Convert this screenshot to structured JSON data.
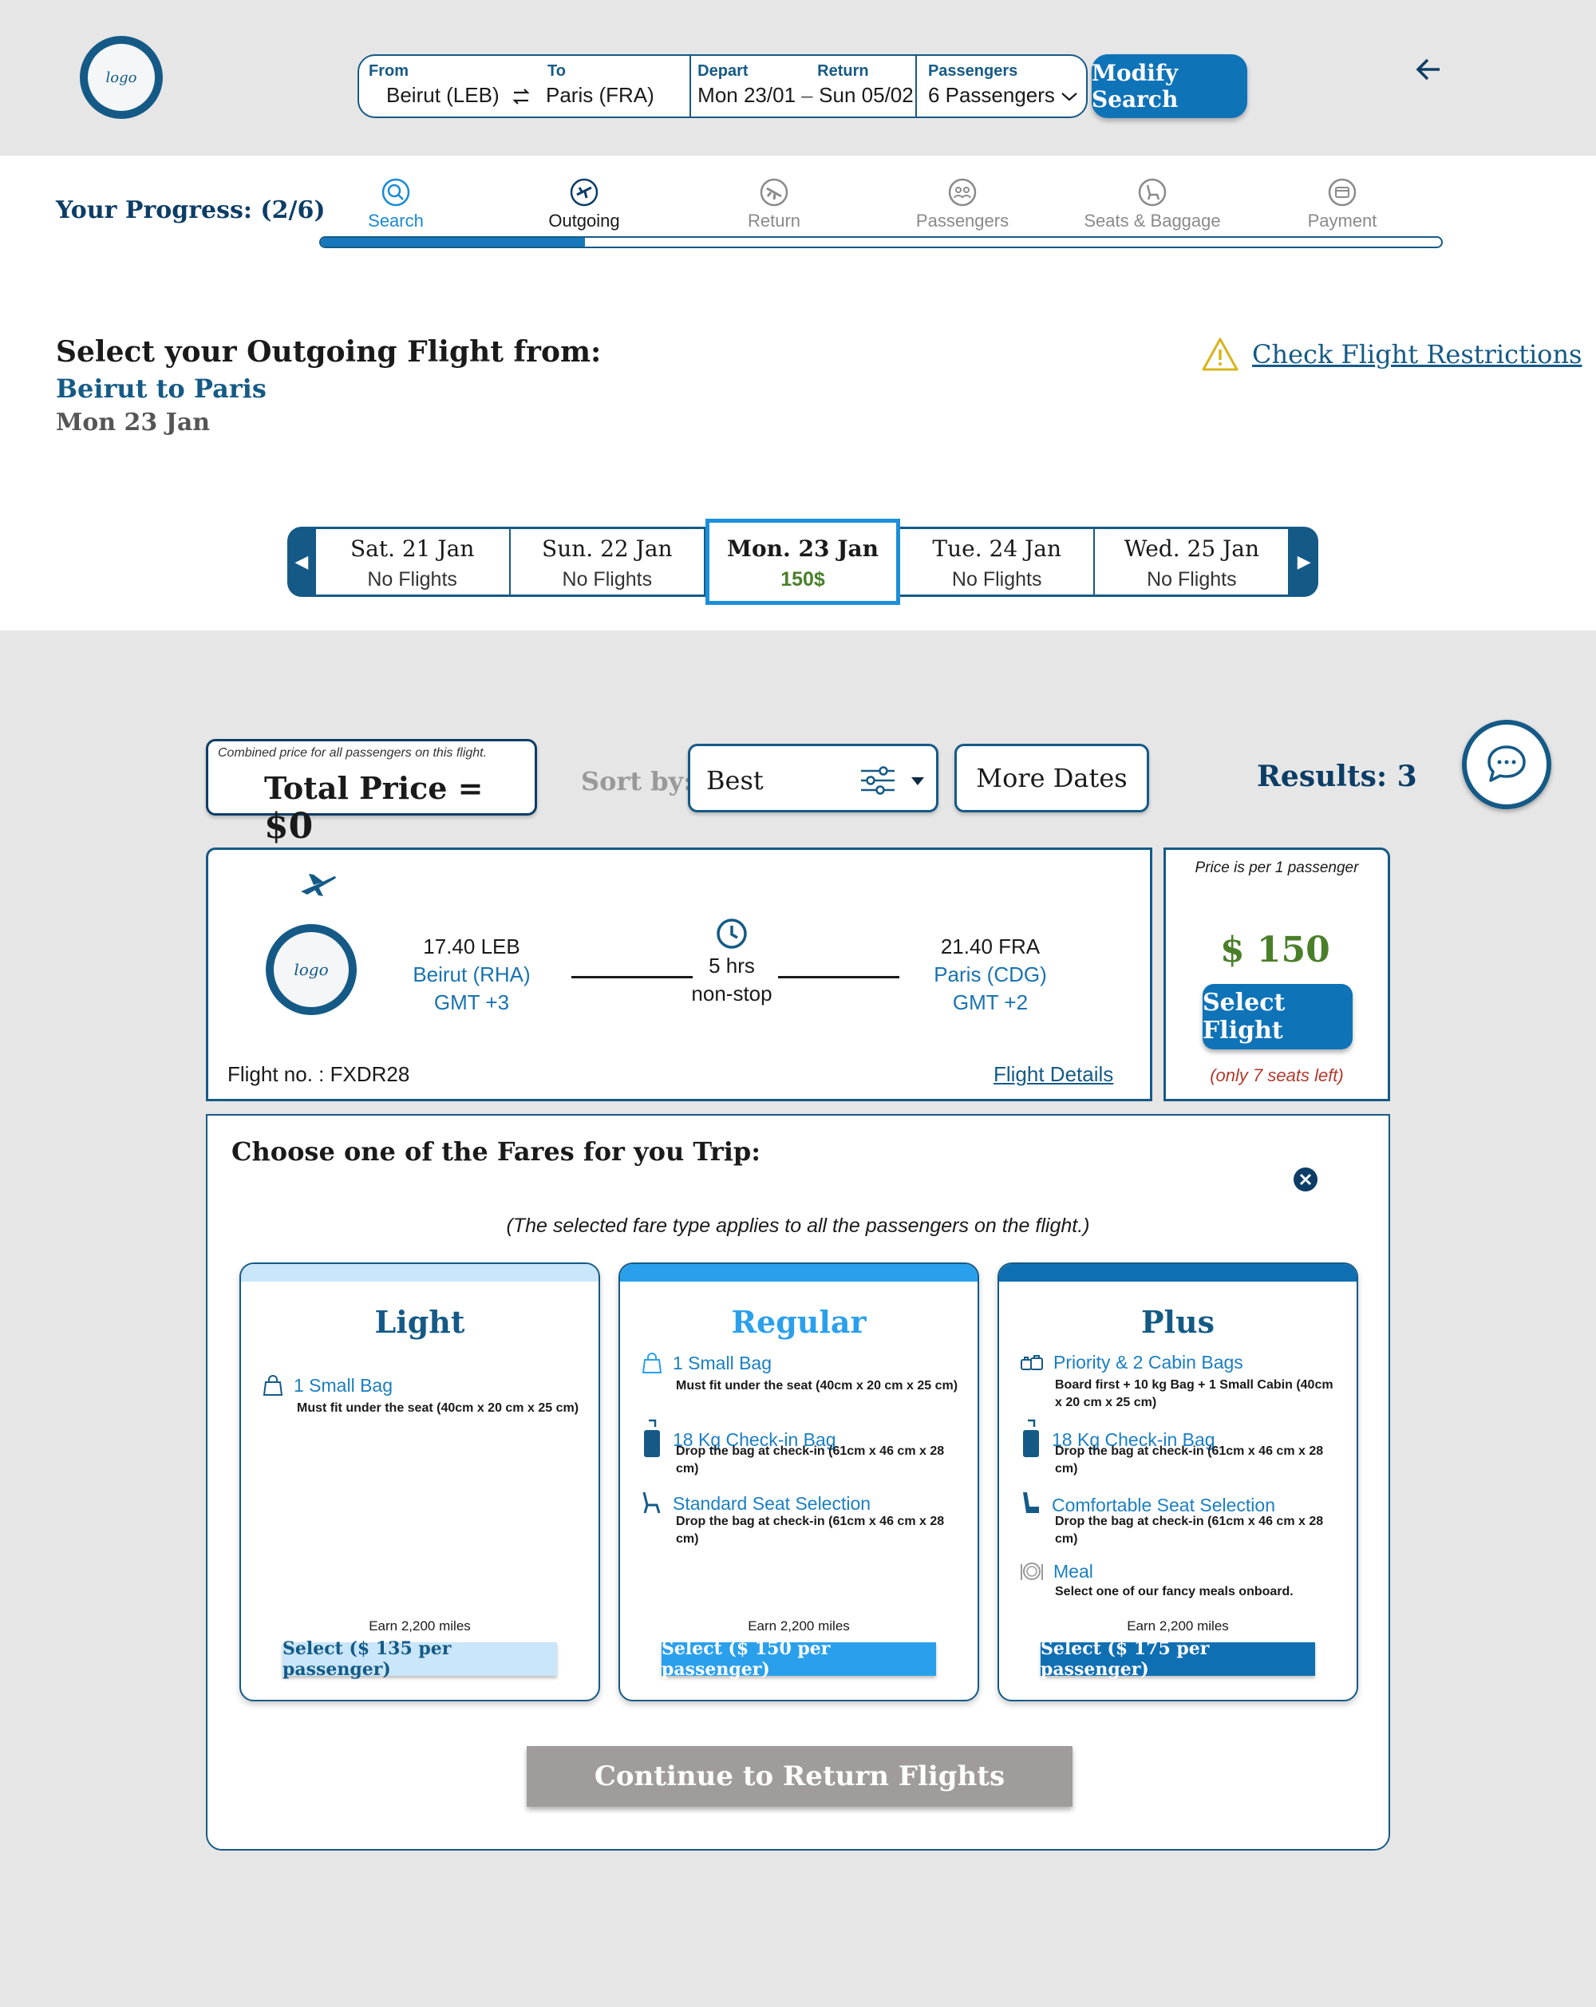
{
  "header": {
    "logo_text": "logo",
    "search": {
      "from_label": "From",
      "from_value": "Beirut (LEB)",
      "to_label": "To",
      "to_value": "Paris (FRA)",
      "depart_label": "Depart",
      "depart_value": "Mon 23/01",
      "date_sep": "–",
      "return_label": "Return",
      "return_value": "Sun 05/02",
      "passengers_label": "Passengers",
      "passengers_value": "6 Passengers"
    },
    "modify_label": "Modify Search"
  },
  "progress": {
    "label": "Your Progress: (2/6)",
    "fraction": 0.236,
    "steps": [
      {
        "label": "Search",
        "icon": "search-icon",
        "state": "done"
      },
      {
        "label": "Outgoing",
        "icon": "plane-icon",
        "state": "current"
      },
      {
        "label": "Return",
        "icon": "plane-landing-icon",
        "state": "todo"
      },
      {
        "label": "Passengers",
        "icon": "passengers-icon",
        "state": "todo"
      },
      {
        "label": "Seats & Baggage",
        "icon": "seat-icon",
        "state": "todo"
      },
      {
        "label": "Payment",
        "icon": "card-icon",
        "state": "todo"
      }
    ]
  },
  "selection": {
    "title": "Select your Outgoing Flight from:",
    "route": "Beirut to Paris",
    "date": "Mon 23 Jan",
    "restrictions_link": "Check Flight Restrictions"
  },
  "dates": [
    {
      "day": "Sat. 21 Jan",
      "price": "No Flights"
    },
    {
      "day": "Sun. 22 Jan",
      "price": "No Flights"
    },
    {
      "day": "Mon. 23 Jan",
      "price": "150$",
      "selected": true
    },
    {
      "day": "Tue. 24 Jan",
      "price": "No Flights"
    },
    {
      "day": "Wed. 25 Jan",
      "price": "No Flights"
    }
  ],
  "controls": {
    "total_note": "Combined price for all passengers on this flight.",
    "total_label": "Total Price =",
    "total_value": "$0",
    "sort_label": "Sort by:",
    "sort_value": "Best",
    "more_dates": "More Dates",
    "results": "Results: 3"
  },
  "flight": {
    "logo_text": "logo",
    "dep_time": "17.40 LEB",
    "dep_airport": "Beirut (RHA)",
    "dep_tz": "GMT +3",
    "duration": "5 hrs",
    "stops": "non-stop",
    "arr_time": "21.40 FRA",
    "arr_airport": "Paris (CDG)",
    "arr_tz": "GMT +2",
    "flight_no": "Flight no. : FXDR28",
    "details_link": "Flight Details",
    "price_note": "Price is per 1 passenger",
    "price": "$ 150",
    "select_label": "Select Flight",
    "seats_left": "(only 7 seats left)"
  },
  "fares": {
    "title": "Choose one of the Fares for you Trip:",
    "note": "(The selected fare type applies to all the passengers on the flight.)",
    "cards": [
      {
        "name": "Light",
        "top_color": "#c9e6fa",
        "name_color": "#155a86",
        "features": [
          {
            "icon": "bag-icon",
            "title": "1 Small Bag",
            "desc": "Must fit under the seat (40cm x 20 cm x 25 cm)"
          }
        ],
        "miles": "Earn 2,200 miles",
        "button": "Select  ($ 135 per passenger)",
        "btn_bg": "#c9e6fa",
        "btn_fg": "#155a86"
      },
      {
        "name": "Regular",
        "top_color": "#2aa0ec",
        "name_color": "#2aa0ec",
        "features": [
          {
            "icon": "bag-icon",
            "title": "1 Small Bag",
            "desc": "Must fit under the seat (40cm x 20 cm x 25 cm)"
          },
          {
            "icon": "luggage-icon",
            "title": "18 Kg Check-in Bag",
            "desc": "Drop the bag at check-in (61cm x 46 cm x 28 cm)"
          },
          {
            "icon": "seat-icon",
            "title": "Standard Seat Selection",
            "desc": "Drop the bag at check-in (61cm x 46 cm x 28 cm)"
          }
        ],
        "miles": "Earn 2,200 miles",
        "button": "Select  ($ 150 per passenger)",
        "btn_bg": "#2aa0ec",
        "btn_fg": "#ffffff"
      },
      {
        "name": "Plus",
        "top_color": "#0f6fb3",
        "name_color": "#155a86",
        "features": [
          {
            "icon": "cabin-bags-icon",
            "title": "Priority & 2 Cabin Bags",
            "desc": "Board first + 10 kg Bag + 1 Small Cabin (40cm x 20 cm x 25 cm)"
          },
          {
            "icon": "luggage-icon",
            "title": "18 Kg Check-in Bag",
            "desc": "Drop the bag at check-in (61cm x 46 cm x 28 cm)"
          },
          {
            "icon": "seat-icon",
            "title": "Comfortable Seat Selection",
            "desc": "Drop the bag at check-in (61cm x 46 cm x 28 cm)"
          },
          {
            "icon": "meal-icon",
            "title": "Meal",
            "desc": "Select one of our fancy meals onboard."
          }
        ],
        "miles": "Earn 2,200 miles",
        "button": "Select  ($ 175 per passenger)",
        "btn_bg": "#0f6fb3",
        "btn_fg": "#ffffff"
      }
    ],
    "continue_label": "Continue to Return Flights"
  }
}
